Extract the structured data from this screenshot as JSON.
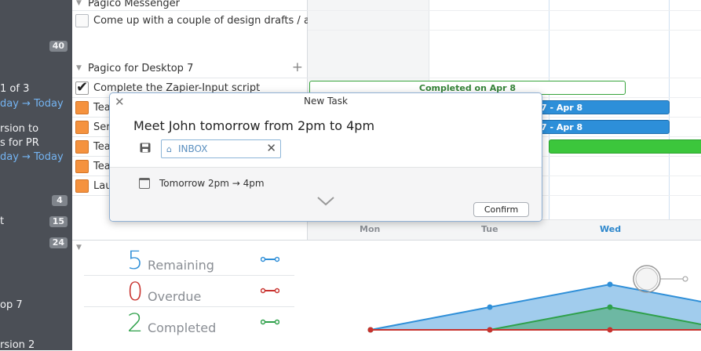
{
  "sidebar": {
    "lines": [
      {
        "text": "1 of 3",
        "color": "white"
      },
      {
        "text": "day → Today",
        "color": "blue"
      },
      {
        "text": "rsion to",
        "color": "white"
      },
      {
        "text": "s for PR",
        "color": "white"
      },
      {
        "text": "day → Today",
        "color": "blue"
      },
      {
        "text": "t",
        "color": "white"
      },
      {
        "text": "op 7",
        "color": "white"
      },
      {
        "text": "rsion 2",
        "color": "white"
      }
    ],
    "badges": [
      "40",
      "4",
      "15",
      "24"
    ]
  },
  "groups": [
    {
      "title": "Pagico Messenger"
    },
    {
      "title": "Pagico for Desktop 7"
    }
  ],
  "tasks": [
    {
      "title": "Come up with a couple of design drafts / a..."
    },
    {
      "title": "Complete the Zapier-Input script"
    },
    {
      "title": "Tea"
    },
    {
      "title": "Ser"
    },
    {
      "title": "Tea"
    },
    {
      "title": "Tea"
    },
    {
      "title": "Lau"
    }
  ],
  "timeline": {
    "bars": [
      {
        "label": "Completed on Apr 8",
        "style": "outline"
      },
      {
        "label": "7 - Apr 8",
        "style": "blue"
      },
      {
        "label": "7 - Apr 8",
        "style": "blue"
      },
      {
        "label": "",
        "style": "green"
      }
    ],
    "days": [
      "Mon",
      "Tue",
      "Wed"
    ]
  },
  "summary": {
    "stats": [
      {
        "value": "5",
        "label": "Remaining",
        "color": "#2f8fd8"
      },
      {
        "value": "0",
        "label": "Overdue",
        "color": "#c8322e"
      },
      {
        "value": "2",
        "label": "Completed",
        "color": "#2ea04a"
      }
    ]
  },
  "chart_data": {
    "type": "area",
    "series": [
      {
        "values": [
          0,
          1,
          2,
          1
        ]
      },
      {
        "values": [
          0,
          0,
          1,
          0
        ]
      },
      {
        "values": [
          0,
          0,
          0,
          0
        ]
      }
    ],
    "colors": [
      "#2f8fd8",
      "#2ea04a",
      "#c8322e"
    ]
  },
  "dialog": {
    "title": "New Task",
    "input_text": "Meet John tomorrow from 2pm to 4pm",
    "inbox_label": "INBOX",
    "date_text": "Tomorrow 2pm → 4pm",
    "confirm_label": "Confirm"
  }
}
